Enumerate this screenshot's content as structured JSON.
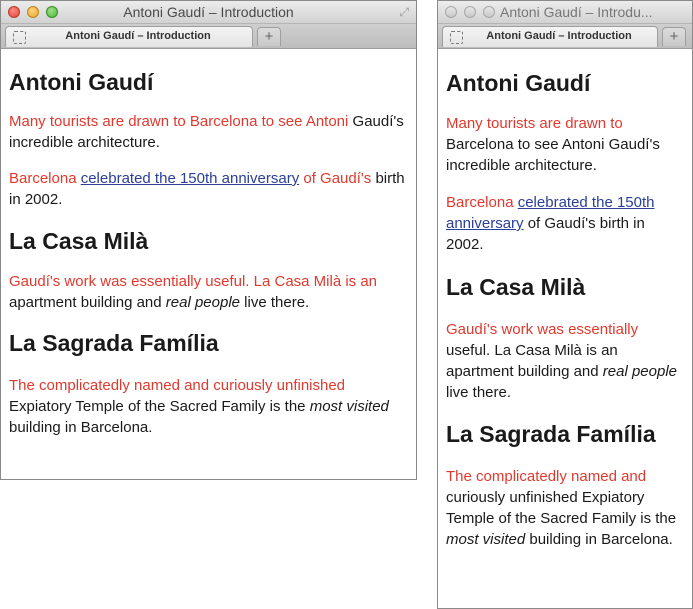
{
  "browser": {
    "window_title": "Antoni Gaudí – Introduction",
    "window_title_truncated": "Antoni Gaudí – Introdu...",
    "tab_label": "Antoni Gaudí – Introduction",
    "new_tab_symbol": "+",
    "resize_symbol": "⤢"
  },
  "page": {
    "heading_gaudi": "Antoni Gaudí",
    "p1_red": "Many tourists are drawn to Barcelona to see Antoni",
    "p1_black": "Gaudí's incredible architecture.",
    "p1_red_narrow": "Many tourists are drawn to",
    "p1_black_narrow": "Barcelona to see Antoni Gaudí's incredible architecture.",
    "p2_red_start": "Barcelona ",
    "p2_link": "celebrated the 150th anniversary",
    "p2_red_end": " of Gaudí's",
    "p2_black": "birth in 2002.",
    "p2_black_narrow": " of Gaudí's birth in 2002.",
    "heading_mila": "La Casa Milà",
    "p3_red": "Gaudí's work was essentially useful. La Casa Milà is an",
    "p3_black_start": "apartment building and ",
    "p3_italic": "real people",
    "p3_black_end": " live there.",
    "p3_red_narrow": "Gaudí's work was essentially",
    "p3_black_narrow_start": "useful. La Casa Milà is an apartment building and ",
    "heading_sagrada": "La Sagrada Família",
    "p4_red": "The complicatedly named and curiously unfinished",
    "p4_black_start": "Expiatory Temple of the Sacred Family is the ",
    "p4_italic": "most visited",
    "p4_black_end": " building in Barcelona.",
    "p4_red_narrow": "The complicatedly named and",
    "p4_black_narrow_start": "curiously unfinished Expiatory Temple of the Sacred Family is the "
  },
  "colors": {
    "highlight_text": "#e0392e",
    "link": "#2a3e9a",
    "body_text": "#1a1a1a"
  }
}
